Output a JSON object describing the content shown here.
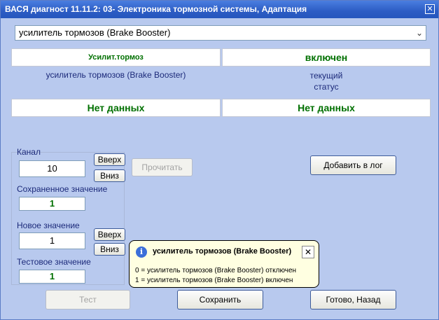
{
  "window": {
    "title": "ВАСЯ диагност 11.11.2: 03- Электроника тормозной системы, Адаптация",
    "ghost": "тормозной",
    "close_icon": "close-icon"
  },
  "selector": {
    "value": "усилитель тормозов (Brake Booster)"
  },
  "status": {
    "name_short": "Усилит.тормоз",
    "value": "включен",
    "name_full": "усилитель тормозов (Brake Booster)",
    "status_label_line1": "текущий",
    "status_label_line2": "статус",
    "nodata_left": "Нет данных",
    "nodata_right": "Нет данных"
  },
  "channel": {
    "label": "Канал",
    "value": "10",
    "up": "Вверх",
    "down": "Вниз",
    "read": "Прочитать"
  },
  "saved": {
    "label": "Сохраненное значение",
    "value": "1"
  },
  "new_value": {
    "label": "Новое значение",
    "value": "1",
    "up": "Вверх",
    "down": "Вниз"
  },
  "test_value": {
    "label": "Тестовое значение",
    "value": "1"
  },
  "buttons": {
    "add_log": "Добавить в лог",
    "test": "Тест",
    "save": "Сохранить",
    "done": "Готово, Назад"
  },
  "tooltip": {
    "title": "усилитель тормозов (Brake Booster)",
    "line1": "0 = усилитель тормозов (Brake Booster) отключен",
    "line2": "1 = усилитель тормозов (Brake Booster) включен",
    "icon": "info-icon",
    "close": "✕"
  },
  "colors": {
    "title_bar": "#2c5cc4",
    "window_bg": "#b8c9ee",
    "value_green": "#007000",
    "label_blue": "#1c2a7a"
  }
}
